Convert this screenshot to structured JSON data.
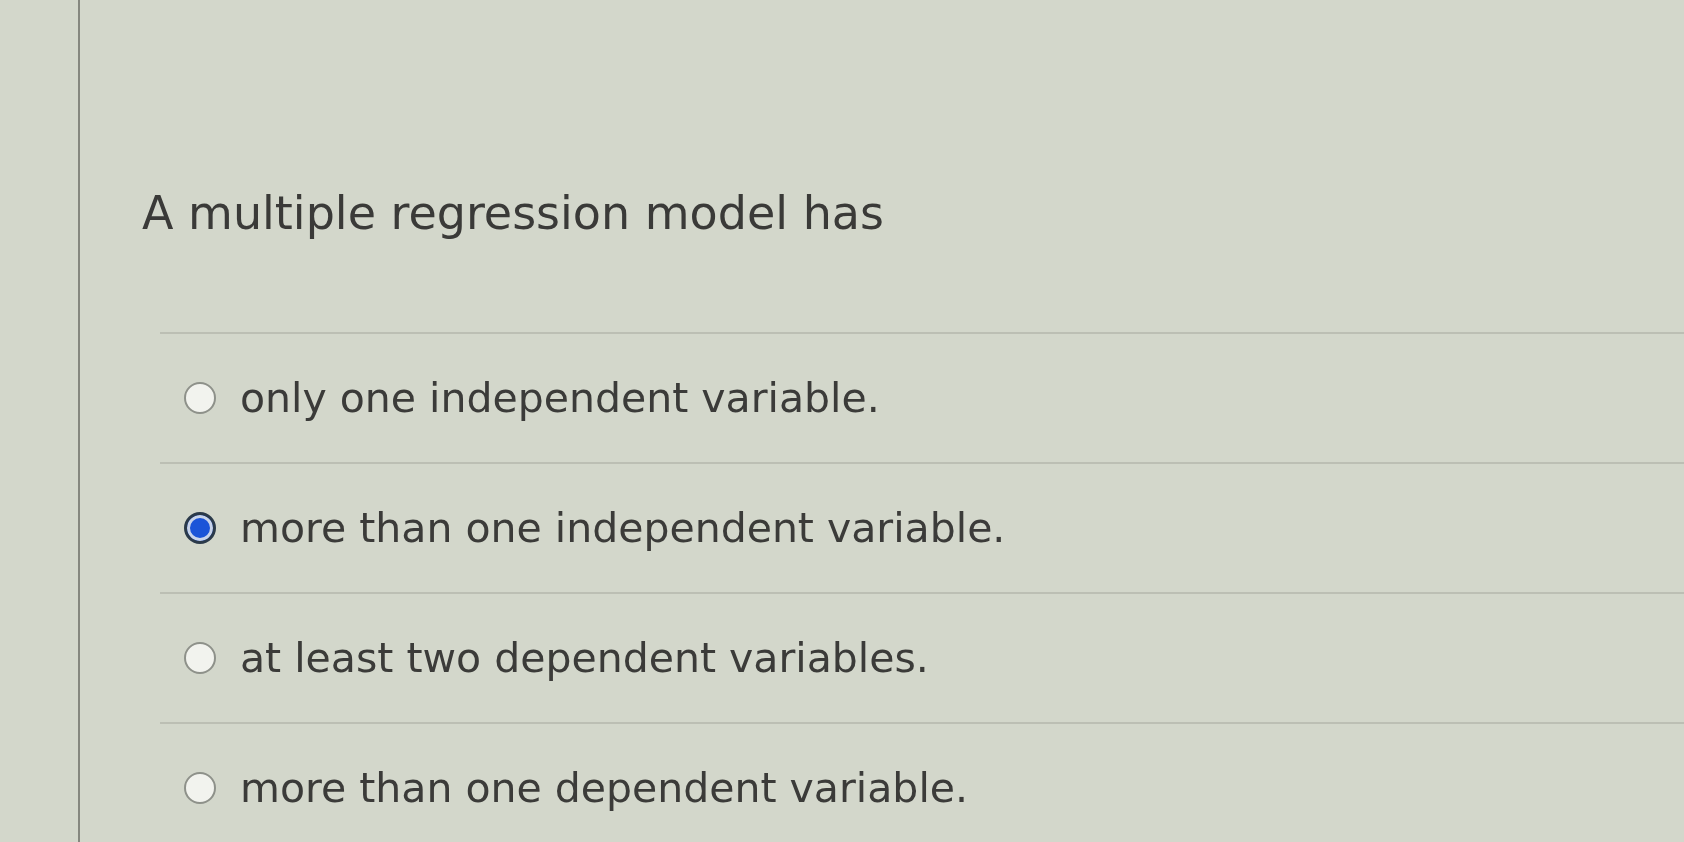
{
  "question": "A multiple regression model has",
  "options": [
    {
      "label": "only one independent variable.",
      "selected": false
    },
    {
      "label": "more than one independent variable.",
      "selected": true
    },
    {
      "label": "at least two dependent variables.",
      "selected": false
    },
    {
      "label": "more than one dependent variable.",
      "selected": false
    }
  ]
}
